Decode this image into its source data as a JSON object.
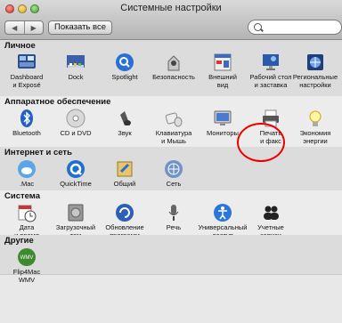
{
  "window": {
    "title": "Системные настройки"
  },
  "toolbar": {
    "back": "◀",
    "forward": "▶",
    "show_all": "Показать все",
    "search_placeholder": ""
  },
  "sections": [
    {
      "title": "Личное",
      "items": [
        {
          "label": "Dashboard\nи Exposé",
          "icon": "dashboard-icon"
        },
        {
          "label": "Dock",
          "icon": "dock-icon"
        },
        {
          "label": "Spotlight",
          "icon": "spotlight-icon"
        },
        {
          "label": "Безопасность",
          "icon": "security-icon"
        },
        {
          "label": "Внешний\nвид",
          "icon": "appearance-icon"
        },
        {
          "label": "Рабочий стол\nи заставка",
          "icon": "desktop-icon"
        },
        {
          "label": "Региональные\nнастройки",
          "icon": "international-icon"
        }
      ]
    },
    {
      "title": "Аппаратное обеспечение",
      "items": [
        {
          "label": "Bluetooth",
          "icon": "bluetooth-icon"
        },
        {
          "label": "CD и DVD",
          "icon": "cd-dvd-icon"
        },
        {
          "label": "Звук",
          "icon": "sound-icon"
        },
        {
          "label": "Клавиатура\nи Мышь",
          "icon": "keyboard-mouse-icon"
        },
        {
          "label": "Мониторы",
          "icon": "displays-icon"
        },
        {
          "label": "Печать\nи факс",
          "icon": "printer-icon"
        },
        {
          "label": "Экономия\nэнергии",
          "icon": "energy-saver-icon"
        }
      ]
    },
    {
      "title": "Интернет и сеть",
      "items": [
        {
          "label": ".Mac",
          "icon": "mac-icon"
        },
        {
          "label": "QuickTime",
          "icon": "quicktime-icon"
        },
        {
          "label": "Общий\nдоступ",
          "icon": "sharing-icon"
        },
        {
          "label": "Сеть",
          "icon": "network-icon"
        }
      ]
    },
    {
      "title": "Система",
      "items": [
        {
          "label": "Дата\nи время",
          "icon": "date-time-icon"
        },
        {
          "label": "Загрузочный\nтом",
          "icon": "startup-disk-icon"
        },
        {
          "label": "Обновление\nпрограмм",
          "icon": "software-update-icon"
        },
        {
          "label": "Речь",
          "icon": "speech-icon"
        },
        {
          "label": "Универсальный\nдоступ",
          "icon": "universal-access-icon"
        },
        {
          "label": "Учетные\nзаписи",
          "icon": "accounts-icon"
        }
      ]
    },
    {
      "title": "Другие",
      "items": [
        {
          "label": "Flip4Mac\nWMV",
          "icon": "flip4mac-icon"
        }
      ]
    }
  ],
  "colors": {
    "highlight": "#e00000"
  }
}
